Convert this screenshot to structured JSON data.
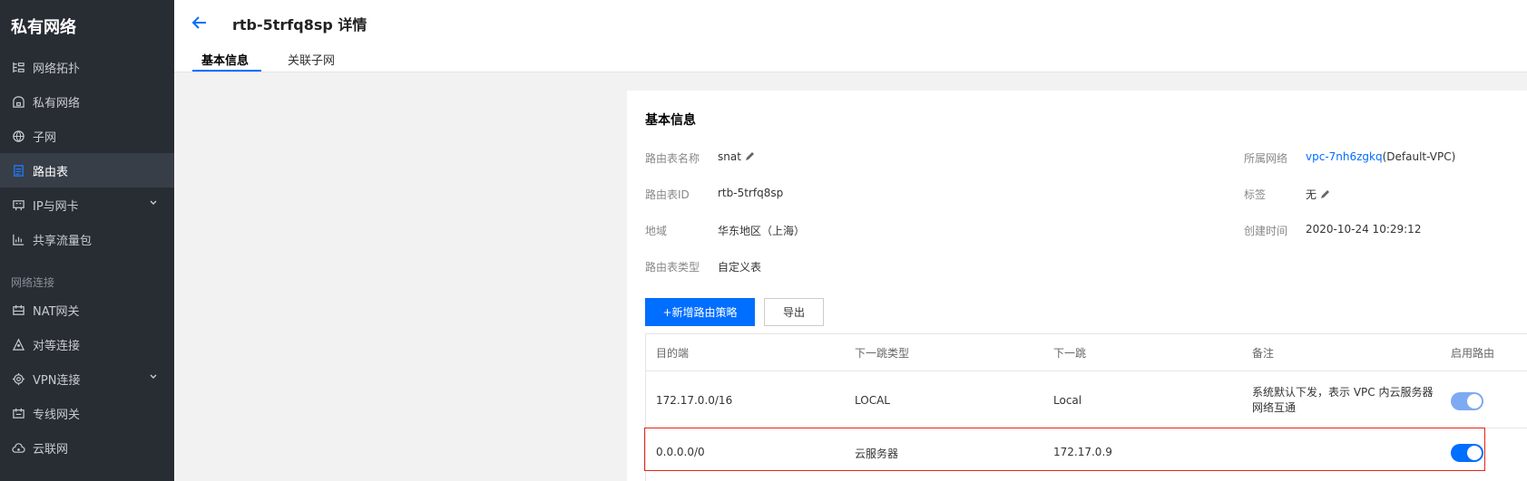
{
  "sidebar": {
    "title": "私有网络",
    "items": [
      {
        "label": "网络拓扑",
        "icon": "topology-icon"
      },
      {
        "label": "私有网络",
        "icon": "vpc-icon"
      },
      {
        "label": "子网",
        "icon": "globe-icon"
      },
      {
        "label": "路由表",
        "icon": "route-table-icon",
        "active": true
      },
      {
        "label": "IP与网卡",
        "icon": "nic-icon"
      },
      {
        "label": "共享流量包",
        "icon": "bar-chart-icon"
      }
    ],
    "section_label": "网络连接",
    "items2": [
      {
        "label": "NAT网关",
        "icon": "nat-gateway-icon"
      },
      {
        "label": "对等连接",
        "icon": "peering-icon"
      },
      {
        "label": "VPN连接",
        "icon": "vpn-icon"
      },
      {
        "label": "专线网关",
        "icon": "dc-gateway-icon"
      },
      {
        "label": "云联网",
        "icon": "ccn-icon"
      }
    ]
  },
  "header": {
    "title": "rtb-5trfq8sp 详情",
    "tabs": [
      "基本信息",
      "关联子网"
    ]
  },
  "basic_info": {
    "section_title": "基本信息",
    "fields_left": [
      {
        "label": "路由表名称",
        "value": "snat"
      },
      {
        "label": "路由表ID",
        "value": "rtb-5trfq8sp"
      },
      {
        "label": "地域",
        "value": "华东地区（上海）"
      },
      {
        "label": "路由表类型",
        "value": "自定义表"
      }
    ],
    "fields_right": [
      {
        "label": "所属网络",
        "value_link": "vpc-7nh6zgkq",
        "value_suffix": "(Default-VPC)"
      },
      {
        "label": "标签",
        "value": "无"
      },
      {
        "label": "创建时间",
        "value": "2020-10-24 10:29:12"
      }
    ]
  },
  "actions": {
    "add_route": "+新增路由策略",
    "export": "导出"
  },
  "route_table": {
    "headers": [
      "目的端",
      "下一跳类型",
      "下一跳",
      "备注",
      "启用路由"
    ],
    "rows": [
      {
        "destination": "172.17.0.0/16",
        "next_hop_type": "LOCAL",
        "next_hop": "Local",
        "note": "系统默认下发，表示 VPC 内云服务器网络互通",
        "enabled": true
      },
      {
        "destination": "0.0.0.0/0",
        "next_hop_type": "云服务器",
        "next_hop": "172.17.0.9",
        "note": "",
        "enabled": true
      }
    ]
  },
  "colors": {
    "sidebar_bg": "#282c33",
    "accent": "#006eff",
    "highlight_border": "#e1251b"
  }
}
